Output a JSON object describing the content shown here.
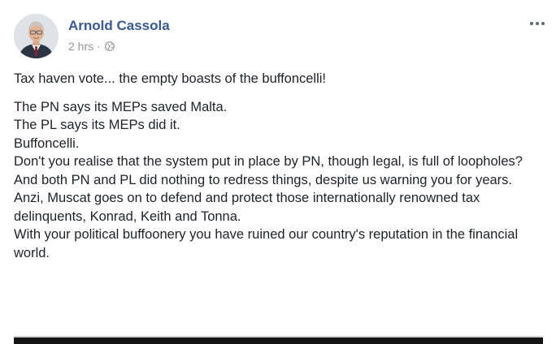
{
  "post": {
    "author": "Arnold Cassola",
    "timestamp": "2 hrs",
    "separator": "·",
    "privacy_icon": "globe-icon",
    "menu_icon": "more-options-icon",
    "avatar_icon": "avatar-photo",
    "text_lead": "Tax haven vote... the empty boasts of the buffoncelli!",
    "lines": [
      "The PN says its MEPs saved Malta.",
      "The PL says its MEPs did it.",
      "Buffoncelli.",
      "Don't you realise that the system put in place by PN, though legal, is full of loopholes?",
      "And both PN and PL did nothing to redress things, despite us warning you for years.",
      "Anzi, Muscat goes on to defend and protect those internationally renowned tax delinquents, Konrad, Keith and Tonna.",
      "With your political buffoonery you have ruined our country's reputation in the financial world."
    ]
  },
  "colors": {
    "name_link": "#385898",
    "meta_text": "#90949c",
    "body_text": "#1d2129"
  }
}
